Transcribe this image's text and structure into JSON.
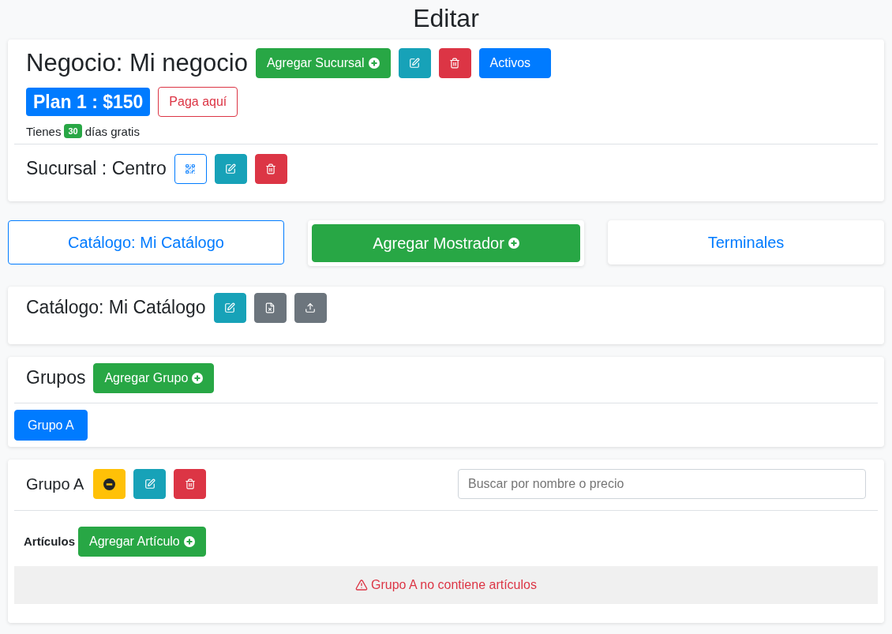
{
  "page_title": "Editar",
  "business": {
    "title": "Negocio: Mi negocio",
    "add_branch_button": "Agregar Sucursal",
    "status_button": "Activos",
    "plan_badge": "Plan 1 : $150",
    "pay_button": "Paga aquí",
    "trial": {
      "prefix": "Tienes",
      "days": "30",
      "suffix": "días gratis"
    },
    "branch": {
      "title": "Sucursal : Centro"
    }
  },
  "tabs": [
    {
      "label": "Catálogo: Mi Catálogo",
      "selected": true,
      "kind": "link"
    },
    {
      "label": "Agregar Mostrador",
      "selected": false,
      "kind": "add"
    },
    {
      "label": "Terminales",
      "selected": false,
      "kind": "link"
    }
  ],
  "catalog": {
    "title": "Catálogo: Mi Catálogo"
  },
  "groups": {
    "title": "Grupos",
    "add_button": "Agregar Grupo",
    "items": [
      {
        "label": "Grupo A",
        "selected": true
      }
    ]
  },
  "group_detail": {
    "title": "Grupo A",
    "search": {
      "placeholder": "Buscar por nombre o precio"
    },
    "articles_label": "Artículos",
    "add_button": "Agregar Artículo",
    "empty_message": "Grupo A no contiene artículos"
  }
}
